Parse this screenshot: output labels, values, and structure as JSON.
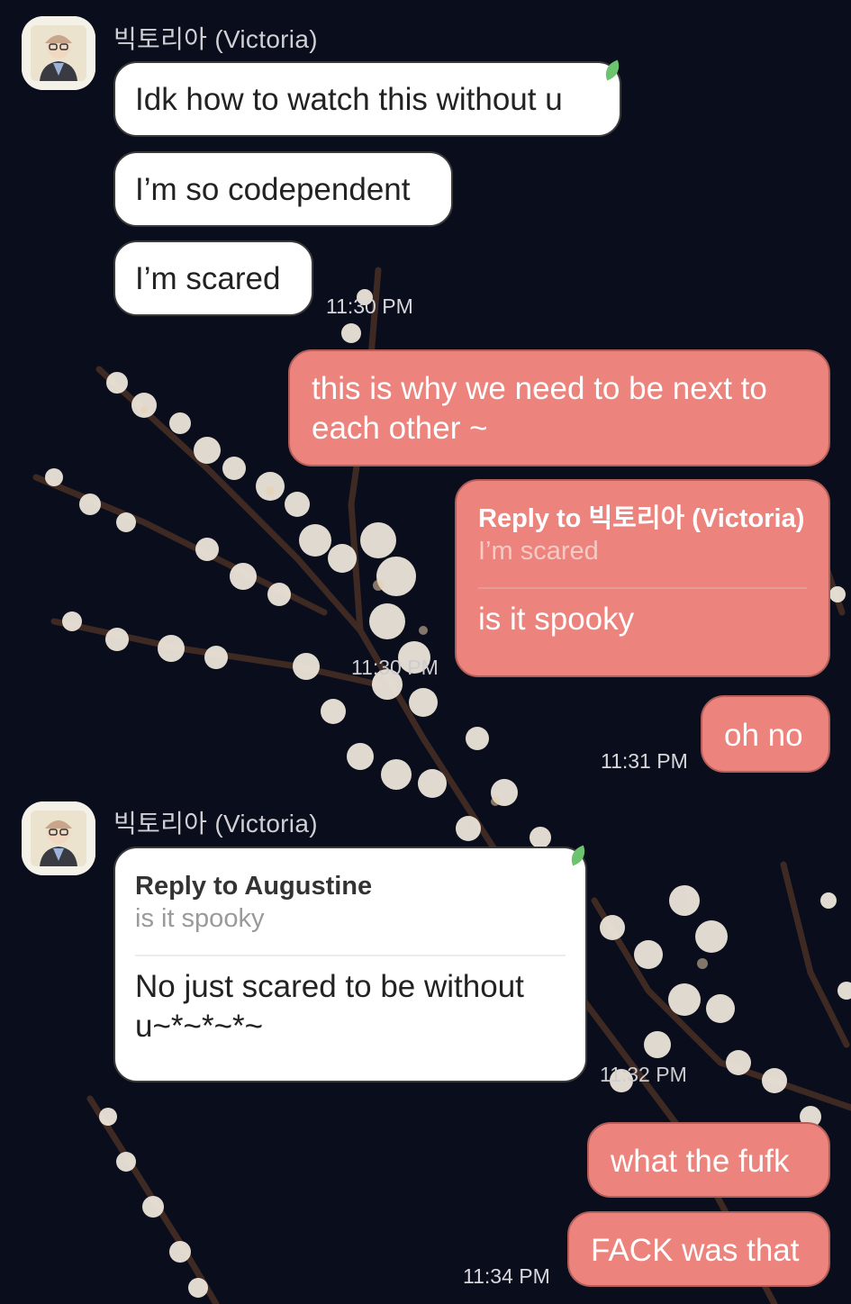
{
  "colors": {
    "background": "#0a0d1c",
    "outgoing_bubble": "#ec837c",
    "incoming_bubble": "#ffffff",
    "leaf_accent": "#6cc46f"
  },
  "messages": [
    {
      "type": "sender",
      "name": "빅토리아 (Victoria)"
    },
    {
      "type": "in",
      "text": "Idk how to watch this without u"
    },
    {
      "type": "in",
      "text": "I’m so codependent"
    },
    {
      "type": "in",
      "text": "I’m scared",
      "time": "11:30 PM"
    },
    {
      "type": "out",
      "text": "this is why we need to be next to each other ~"
    },
    {
      "type": "out",
      "reply_to": "Reply to 빅토리아 (Victoria)",
      "quote": "I’m scared",
      "text": "is it spooky",
      "time": "11:30 PM"
    },
    {
      "type": "out",
      "text": "oh no",
      "time": "11:31 PM"
    },
    {
      "type": "sender",
      "name": "빅토리아 (Victoria)"
    },
    {
      "type": "in",
      "reply_to": "Reply to Augustine",
      "quote": "is it spooky",
      "text": "No just scared to be without u~*~*~*~",
      "time": "11:32 PM"
    },
    {
      "type": "out",
      "text": "what the fufk"
    },
    {
      "type": "out",
      "text": "FACK was that",
      "time": "11:34 PM"
    }
  ],
  "avatar_icon": "person-with-glasses-avatar-icon",
  "background_image": "cherry-blossom-branches"
}
